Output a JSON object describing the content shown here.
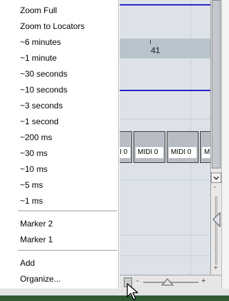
{
  "menu": {
    "zoom_items": [
      "Zoom Full",
      "Zoom to Locators",
      "~6 minutes",
      "~1 minute",
      "~30 seconds",
      "~10 seconds",
      "~3 seconds",
      "~1 second",
      "~200 ms",
      "~30 ms",
      "~10 ms",
      "~5 ms",
      "~1 ms"
    ],
    "marker_items": [
      "Marker 2",
      "Marker 1"
    ],
    "preset_items": [
      "Add",
      "Organize..."
    ]
  },
  "track": {
    "locator_number": "41",
    "parts": [
      "I 0",
      "MIDI 0",
      "MIDI 0",
      "M"
    ]
  },
  "zoom": {
    "minus": "-",
    "plus": "+"
  },
  "colors": {
    "accent_line": "#2323c8",
    "locator_range": "#b8c4cc",
    "status_bar": "#2f5a34"
  }
}
